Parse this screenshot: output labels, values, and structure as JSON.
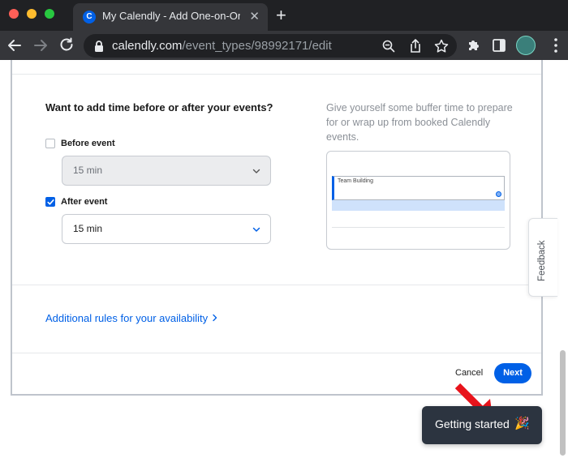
{
  "browser": {
    "tab_title": "My Calendly - Add One-on-One",
    "tab_close": "✕",
    "new_tab": "+",
    "url_domain": "calendly.com",
    "url_path": "/event_types/98992171/edit"
  },
  "buffer_section": {
    "title": "Want to add time before or after your events?",
    "before": {
      "label": "Before event",
      "checked": false,
      "value": "15 min"
    },
    "after": {
      "label": "After event",
      "checked": true,
      "value": "15 min"
    },
    "helper_text": "Give yourself some buffer time to prepare for or wrap up from booked Calendly events.",
    "preview_event_title": "Team Building"
  },
  "rules_link": "Additional rules for your availability",
  "footer": {
    "cancel_label": "Cancel",
    "next_label": "Next"
  },
  "feedback_label": "Feedback",
  "getting_started": {
    "label": "Getting started",
    "icon": "🎉"
  },
  "colors": {
    "accent": "#0060e6",
    "annotation_arrow": "#e8131b"
  }
}
